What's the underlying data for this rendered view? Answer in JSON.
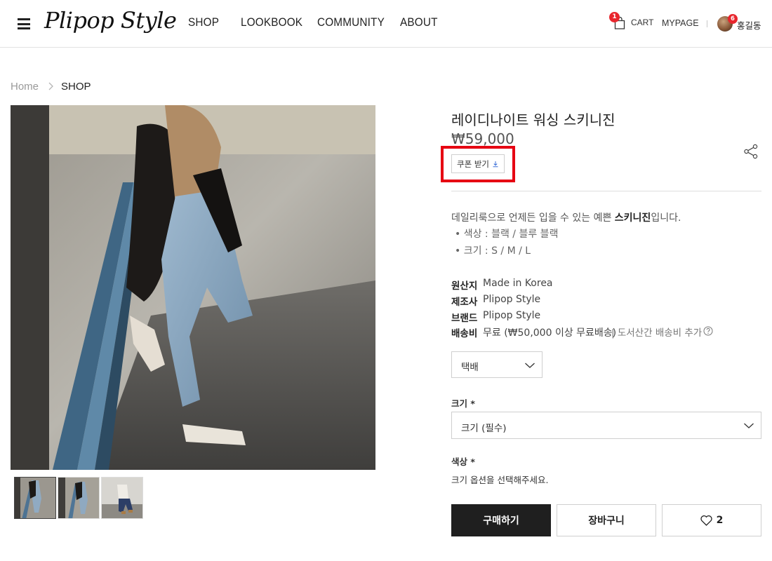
{
  "header": {
    "logo": "Plipop Style",
    "nav": [
      "SHOP",
      "LOOKBOOK",
      "COMMUNITY",
      "ABOUT"
    ],
    "cart_label": "CART",
    "cart_count": "1",
    "mypage_label": "MYPAGE",
    "notification_count": "6",
    "username": "홍길동"
  },
  "breadcrumb": {
    "home": "Home",
    "current": "SHOP"
  },
  "product": {
    "title": "레이디나이트 워싱 스키니진",
    "price": "₩59,000",
    "coupon_label": "쿠폰 받기",
    "description_prefix": "데일리룩으로 언제든 입을 수 있는 예쁜 ",
    "description_bold": "스키니진",
    "description_suffix": "입니다.",
    "bullets": [
      "색상 : 블랙 / 블루 블랙",
      "크기 : S / M / L"
    ],
    "specs": {
      "origin_key": "원산지",
      "origin_value": "Made in Korea",
      "maker_key": "제조사",
      "maker_value": "Plipop Style",
      "brand_key": "브랜드",
      "brand_value": "Plipop Style",
      "shipping_key": "배송비",
      "shipping_value": "무료 (₩50,000 이상 무료배송)",
      "shipping_extra": "도서산간 배송비 추가"
    },
    "shipping_method": "택배",
    "size_label": "크기",
    "size_placeholder": "크기 (필수)",
    "color_label": "색상",
    "color_hint": "크기 옵션을 선택해주세요.",
    "required_mark": "*"
  },
  "actions": {
    "buy": "구매하기",
    "cart": "장바구니",
    "like_count": "2"
  },
  "colors": {
    "badge": "#e8262d",
    "highlight": "#e60012",
    "buy_button": "#1f1f1f"
  }
}
